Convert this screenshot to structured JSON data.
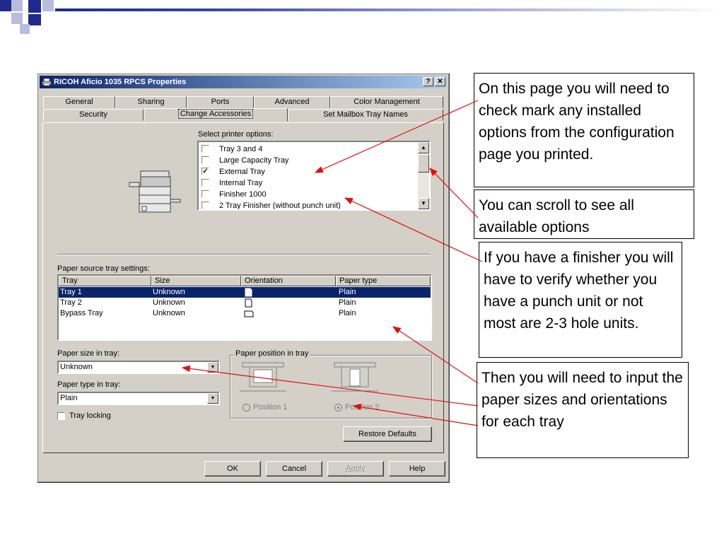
{
  "dialog": {
    "title": "RICOH Aficio 1035 RPCS Properties",
    "help_button": "?",
    "close_button": "✕",
    "tabs_row1": [
      "General",
      "Sharing",
      "Ports",
      "Advanced",
      "Color Management"
    ],
    "tabs_row2": [
      "Security",
      "Change Accessories",
      "Set Mailbox Tray Names"
    ],
    "active_tab": "Change Accessories",
    "select_label": "Select printer options:",
    "options": [
      {
        "label": "Tray 3 and 4",
        "checked": false
      },
      {
        "label": "Large Capacity Tray",
        "checked": false
      },
      {
        "label": "External Tray",
        "checked": true
      },
      {
        "label": "Internal Tray",
        "checked": false
      },
      {
        "label": "Finisher 1000",
        "checked": false
      },
      {
        "label": "2 Tray Finisher (without punch unit)",
        "checked": false
      }
    ],
    "tray_settings_label": "Paper source tray settings:",
    "table": {
      "columns": [
        "Tray",
        "Size",
        "Orientation",
        "Paper type"
      ],
      "rows": [
        {
          "tray": "Tray 1",
          "size": "Unknown",
          "orientation": "portrait",
          "type": "Plain",
          "selected": true
        },
        {
          "tray": "Tray 2",
          "size": "Unknown",
          "orientation": "portrait",
          "type": "Plain",
          "selected": false
        },
        {
          "tray": "Bypass Tray",
          "size": "Unknown",
          "orientation": "landscape",
          "type": "Plain",
          "selected": false
        }
      ]
    },
    "paper_size_label": "Paper size in tray:",
    "paper_size_value": "Unknown",
    "paper_type_label": "Paper type in tray:",
    "paper_type_value": "Plain",
    "tray_locking_label": "Tray locking",
    "paper_position_label": "Paper position in tray",
    "position1_label": "Position 1",
    "position2_label": "Position 2",
    "restore_defaults": "Restore Defaults",
    "ok": "OK",
    "cancel": "Cancel",
    "apply": "Apply",
    "help": "Help",
    "colors": {
      "titlebar_start": "#0a246a",
      "titlebar_end": "#a6caf0",
      "face": "#d4d0c8",
      "selection": "#0a246a"
    }
  },
  "callouts": {
    "c1": "On this page you will need to check mark any installed options from the configuration page you printed.",
    "c2": "You can scroll to see all available options",
    "c3": "If you have a finisher you will have to verify whether you have a punch unit or not most are 2-3 hole units.",
    "c4": "Then you will need to input the paper sizes and orientations for each tray"
  },
  "colors": {
    "arrow": "#e01010",
    "slide_accent": "#1f2a8c"
  }
}
